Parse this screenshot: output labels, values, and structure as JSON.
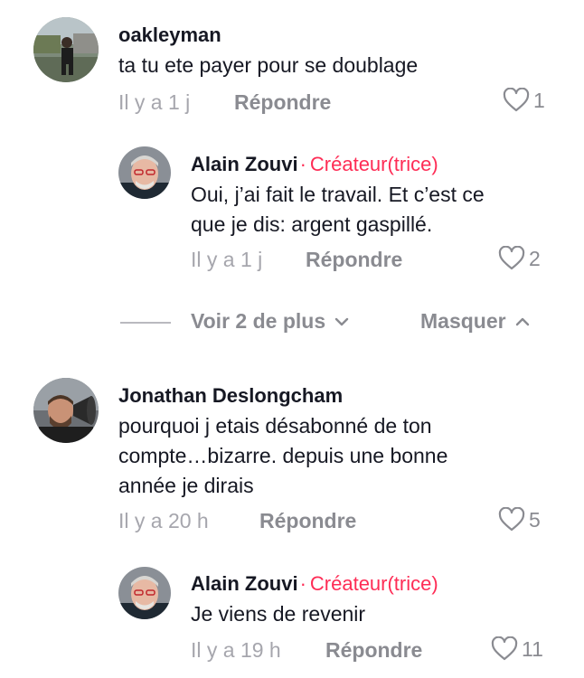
{
  "comments": [
    {
      "username": "oakleyman",
      "text": "ta tu ete payer pour se doublage",
      "time": "Il y a 1 j",
      "reply_label": "Répondre",
      "likes": "1"
    },
    {
      "username": "Alain Zouvi",
      "badge": "Créateur(trice)",
      "separator": "·",
      "text_lines": [
        "Oui, j’ai fait le travail. Et c’est ce",
        "que je dis: argent gaspillé."
      ],
      "time": "Il y a 1 j",
      "reply_label": "Répondre",
      "likes": "2"
    },
    {
      "username": "Jonathan Deslongcham",
      "text_lines": [
        "pourquoi j etais désabonné de ton",
        "compte…bizarre. depuis une bonne",
        "année je dirais"
      ],
      "time": "Il y a 20 h",
      "reply_label": "Répondre",
      "likes": "5"
    },
    {
      "username": "Alain Zouvi",
      "badge": "Créateur(trice)",
      "separator": "·",
      "text": "Je viens de revenir",
      "time": "Il y a 19 h",
      "reply_label": "Répondre",
      "likes": "11"
    }
  ],
  "thread_controls": {
    "view_more": "Voir 2 de plus",
    "hide": "Masquer"
  },
  "colors": {
    "creator_badge": "#fe2c55",
    "muted": "#8a8b91",
    "time": "#a6a6ad"
  },
  "icons": [
    "heart-icon",
    "chevron-down-icon",
    "chevron-up-icon"
  ]
}
